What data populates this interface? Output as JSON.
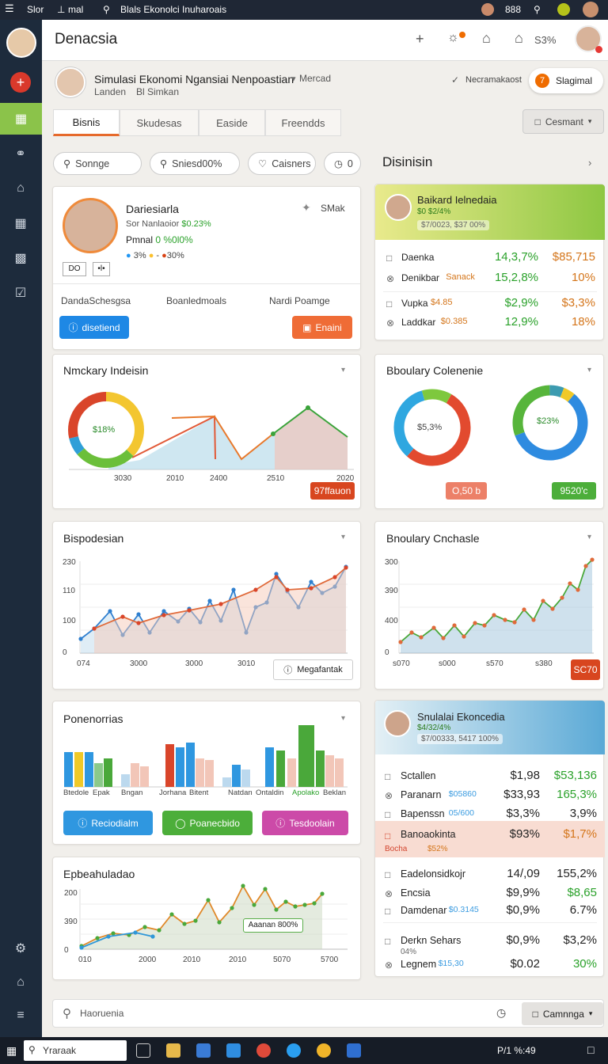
{
  "osbar": {
    "app": "Slor",
    "menu": "mal",
    "search": "Blals Ekonolci Inuharoais",
    "count": "888"
  },
  "header": {
    "title": "Denacsia",
    "stat": "S3%"
  },
  "profile": {
    "title": "Simulasi Ekonomi Ngansiai Nenpoastian",
    "title_tag": "Mercad",
    "sub": "Landen",
    "sub2": "Bl Simkan",
    "status_label": "Necramakaost",
    "signal_label": "Slagimal",
    "signal_num": "7"
  },
  "tabs": [
    "Bisnis",
    "Skudesas",
    "Easide",
    "Freendds"
  ],
  "comment_label": "Cesmant",
  "filters": [
    "Sonnge",
    "Sniesd00%",
    "Caisners",
    "0"
  ],
  "person_card": {
    "name": "Dariesiarla",
    "simak": "SMak",
    "line1a": "Sor Nanlaoior",
    "line1b": "$0.23%",
    "line2a": "Pmnal",
    "line2b": "0 %0l0%",
    "line3a": "3%",
    "line3b": "30%",
    "box1": "DO",
    "box2": "•l•",
    "col1": "DandaSchesgsa",
    "col2": "Boanledmoals",
    "col3": "Nardi Poamge",
    "btn_left": "disetiend",
    "btn_right": "Enaini"
  },
  "right_panel": {
    "title": "Disinisin",
    "card1": {
      "name": "Baikard Ielnedaia",
      "sub1": "$0 $2/4%",
      "sub2": "$7/0023, $37 00%",
      "rows": [
        {
          "label": "Daenka",
          "tag": "",
          "a": "14,3,7%",
          "b": "$85,715"
        },
        {
          "label": "Denikbar",
          "tag": "Sanack",
          "a": "15,2,8%",
          "b": "10%"
        },
        {
          "label": "Vupka",
          "tag": "$4.85",
          "a": "$2,9%",
          "b": "$3,3%"
        },
        {
          "label": "Laddkar",
          "tag": "$0.385",
          "a": "12,9%",
          "b": "18%"
        }
      ]
    }
  },
  "chart1": {
    "title": "Nmckary Indeisin",
    "donut_label": "$18%",
    "ticks": [
      "3030",
      "2010",
      "2400",
      "2510",
      "2020"
    ],
    "badge": "97ffauon"
  },
  "chart2": {
    "title": "Bboulary Colenenie",
    "d1": "$5,3%",
    "d2": "$23%",
    "badge_left": "O,50 b",
    "badge_right": "9520'c"
  },
  "chart3": {
    "title": "Bispodesian",
    "yt": [
      "230",
      "110",
      "100",
      "0"
    ],
    "xt": [
      "074",
      "3000",
      "3000",
      "3010"
    ],
    "btn": "Megafantak"
  },
  "chart4": {
    "title": "Bnoulary Cnchasle",
    "yt": [
      "300",
      "390",
      "400",
      "0"
    ],
    "xt": [
      "s070",
      "s000",
      "s570",
      "s380"
    ],
    "badge": "SC70"
  },
  "chart5": {
    "title": "Ponenorrias",
    "cats": [
      "Btedole",
      "Epak",
      "Bngan",
      "Jorhana",
      "Bitent",
      "Natdan",
      "Ontaldin",
      "Apolako",
      "Beklan"
    ],
    "buttons": [
      "Reciodialm",
      "Poanecbido",
      "Tesdoolain"
    ]
  },
  "chart6": {
    "title": "Epbeahuladao",
    "yt": [
      "200",
      "390",
      "0"
    ],
    "xt": [
      "010",
      "2000",
      "2010",
      "2010",
      "5070",
      "5700"
    ],
    "annotation": "Aaanan 800%"
  },
  "sim_panel": {
    "name": "Snulalai Ekoncedia",
    "sub1": "$4/32/4%",
    "sub2": "$7/00333, 5417 100%",
    "rows1": [
      {
        "label": "Sctallen",
        "tag": "",
        "a": "$1,98",
        "b": "$53,136"
      },
      {
        "label": "Paranarn",
        "tag": "$05860",
        "a": "$33,93",
        "b": "165,3%"
      },
      {
        "label": "Bapenssn",
        "tag": "05/600",
        "a": "$3,3%",
        "b": "3,9%"
      }
    ],
    "hl": {
      "label": "Banoaokinta",
      "tag": "Bocha",
      "tag2": "$52%",
      "a": "$93%",
      "b": "$1,7%"
    },
    "rows2": [
      {
        "label": "Eadelonsidkojr",
        "a": "14/,09",
        "b": "155,2%"
      },
      {
        "label": "Encsia",
        "a": "$9,9%",
        "b": "$8,65"
      },
      {
        "label": "Damdenar",
        "tag": "$0.3145",
        "a": "$0,9%",
        "b": "6.7%"
      }
    ],
    "rows3": [
      {
        "label": "Derkn Sehars",
        "sub": "04%",
        "a": "$0,9%",
        "b": "$3,2%"
      },
      {
        "label": "Legnem",
        "tag": "$15,30",
        "a": "$0.02",
        "b": "30%"
      }
    ]
  },
  "bottom": {
    "search": "Haoruenia",
    "btn": "Camnnga"
  },
  "taskbar": {
    "search": "Yraraak",
    "tray": "P/1 %:49"
  }
}
